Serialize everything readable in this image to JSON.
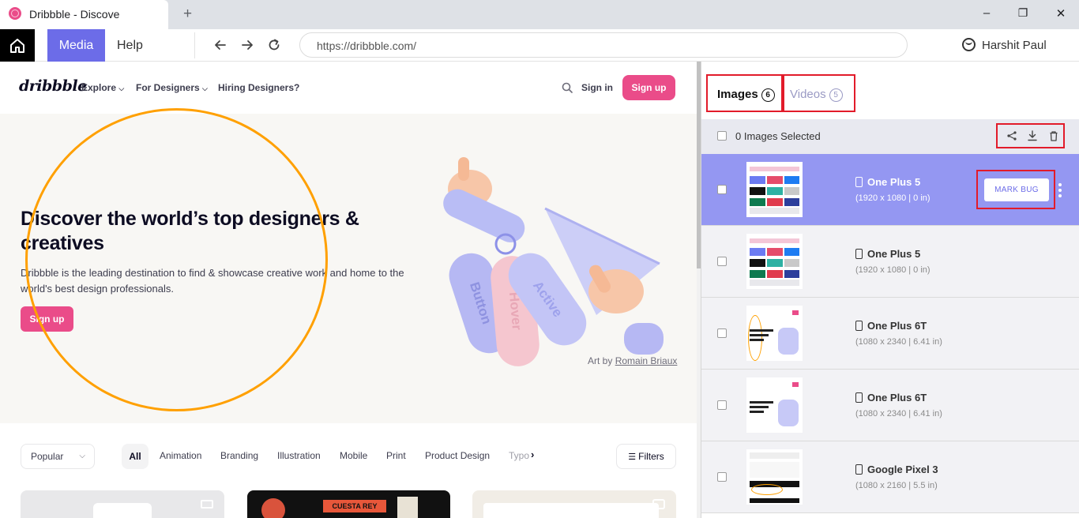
{
  "browser": {
    "tab_title": "Dribbble - Discove",
    "new_tab": "+",
    "minimize": "–",
    "restore": "❐",
    "close": "✕"
  },
  "toolbar": {
    "media_label": "Media",
    "help_label": "Help",
    "url": "https://dribbble.com/",
    "user_name": "Harshit Paul"
  },
  "site": {
    "logo": "dribbble",
    "nav": [
      "Explore",
      "For Designers",
      "Hiring Designers?"
    ],
    "signin": "Sign in",
    "signup": "Sign up",
    "hero_title": "Discover the world’s top designers & creatives",
    "hero_subtitle": "Dribbble is the leading destination to find & showcase creative work and home to the world's best design professionals.",
    "hero_button": "Sign up",
    "art_credit_prefix": "Art by ",
    "art_credit_name": "Romain Briaux",
    "art_tags": [
      "Button",
      "Hover",
      "Active"
    ],
    "popular_select": "Popular",
    "categories": [
      "All",
      "Animation",
      "Branding",
      "Illustration",
      "Mobile",
      "Print",
      "Product Design",
      "Typo"
    ],
    "filters": "Filters",
    "shot_text": "CUESTA REY CIGARS"
  },
  "panel": {
    "tabs": [
      {
        "label": "Images",
        "count": "6"
      },
      {
        "label": "Videos",
        "count": "5"
      }
    ],
    "selected_text": "0 Images Selected",
    "mark_bug": "MARK BUG",
    "items": [
      {
        "device": "One Plus 5",
        "meta": "(1920 x 1080 | 0 in)",
        "active": true
      },
      {
        "device": "One Plus 5",
        "meta": "(1920 x 1080 | 0 in)",
        "active": false
      },
      {
        "device": "One Plus 6T",
        "meta": "(1080 x 2340 | 6.41 in)",
        "active": false
      },
      {
        "device": "One Plus 6T",
        "meta": "(1080 x 2340 | 6.41 in)",
        "active": false
      },
      {
        "device": "Google Pixel 3",
        "meta": "(1080 x 2160 | 5.5 in)",
        "active": false
      }
    ]
  },
  "colors": {
    "accent": "#6c6ce8",
    "brand_pink": "#ea4c89",
    "annotation_orange": "#ffa000",
    "highlight_red": "#e21b2a",
    "active_row": "#9497f2"
  }
}
